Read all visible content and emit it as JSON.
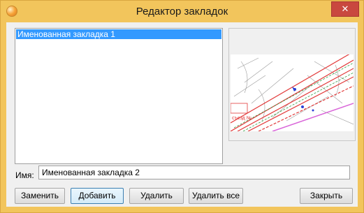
{
  "window": {
    "title": "Редактор закладок",
    "close_glyph": "✕",
    "accent_color": "#f2c55c"
  },
  "bookmarks": {
    "items": [
      {
        "label": "Именованная закладка 1",
        "selected": true
      }
    ]
  },
  "name_field": {
    "label": "Имя:",
    "value": "Именованная закладка 2"
  },
  "buttons": {
    "replace": "Заменить",
    "add": "Добавить",
    "delete": "Удалить",
    "delete_all": "Удалить все",
    "close": "Закрыть"
  },
  "preview": {
    "map_label": "съезд №"
  }
}
